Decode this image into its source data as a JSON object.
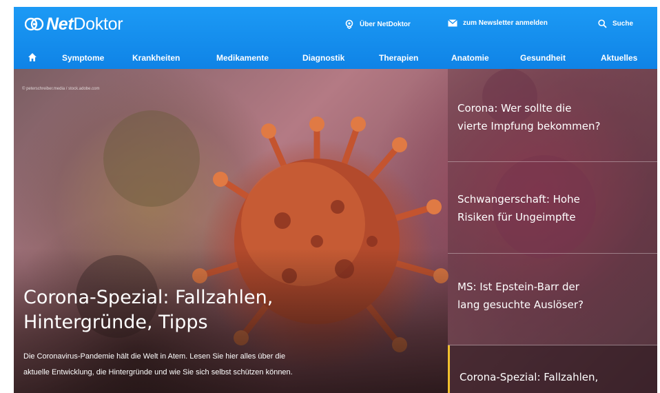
{
  "header": {
    "logo_net": "Net",
    "logo_doktor": "Doktor",
    "about_label": "Über NetDoktor",
    "newsletter_label": "zum Newsletter anmelden",
    "search_label": "Suche",
    "colors": {
      "header_blue": "#1790ef",
      "accent_yellow": "#f2c12e"
    }
  },
  "nav": {
    "items": [
      "Symptome",
      "Krankheiten",
      "Medikamente",
      "Diagnostik",
      "Therapien",
      "Anatomie",
      "Gesundheit",
      "Aktuelles"
    ]
  },
  "hero": {
    "copyright": "© peterschreiber.media / stock.adobe.com",
    "title_line1": "Corona-Spezial: Fallzahlen,",
    "title_line2": "Hintergründe, Tipps",
    "desc_line1": "Die Coronavirus-Pandemie hält die Welt in Atem. Lesen Sie hier alles über die",
    "desc_line2": "aktuelle Entwicklung, die Hintergründe und wie Sie sich selbst schützen können."
  },
  "sidebar": {
    "items": [
      {
        "line1": "Corona: Wer sollte die",
        "line2": "vierte Impfung bekommen?"
      },
      {
        "line1": "Schwangerschaft: Hohe",
        "line2": "Risiken für Ungeimpfte"
      },
      {
        "line1": "MS: Ist Epstein-Barr der",
        "line2": "lang gesuchte Auslöser?"
      },
      {
        "line1": "Corona-Spezial: Fallzahlen,",
        "line2": ""
      }
    ]
  }
}
